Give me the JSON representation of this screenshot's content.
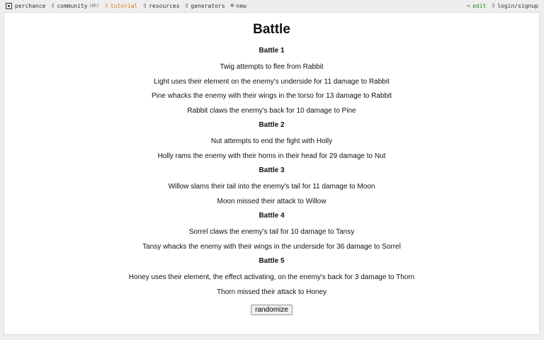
{
  "nav": {
    "left": [
      {
        "icon": "dice-icon",
        "label": "perchance"
      },
      {
        "icon": "chat-icon",
        "label": "community",
        "count": "(8h)"
      },
      {
        "icon": "book-icon",
        "label": "tutorial"
      },
      {
        "icon": "folder-icon",
        "label": "resources"
      },
      {
        "icon": "list-icon",
        "label": "generators"
      },
      {
        "icon": "plus-icon",
        "label": "new"
      }
    ],
    "right": [
      {
        "icon": "pencil-icon",
        "label": "edit"
      },
      {
        "icon": "user-icon",
        "label": "login/signup"
      }
    ]
  },
  "colors": {
    "tutorial": "#e07b18",
    "edit": "#2a8a2a"
  },
  "page": {
    "title": "Battle",
    "battles": [
      {
        "heading": "Battle 1",
        "lines": [
          "Twig attempts to flee from Rabbit",
          "Light uses their element on the enemy's underside for 11 damage to Rabbit",
          "Pine whacks the enemy with their wings in the torso for 13 damage to Rabbit",
          "Rabbit claws the enemy's back for 10 damage to Pine"
        ]
      },
      {
        "heading": "Battle 2",
        "lines": [
          "Nut attempts to end the fight with Holly",
          "Holly rams the enemy with their horns in their head for 29 damage to Nut"
        ]
      },
      {
        "heading": "Battle 3",
        "lines": [
          "Willow slams their tail into the enemy's tail for 11 damage to Moon",
          "Moon missed their attack to Willow"
        ]
      },
      {
        "heading": "Battle 4",
        "lines": [
          "Sorrel claws the enemy's tail for 10 damage to Tansy",
          "Tansy whacks the enemy with their wings in the underside for 36 damage to Sorrel"
        ]
      },
      {
        "heading": "Battle 5",
        "lines": [
          "Honey uses their element, the effect activating, on the enemy's back for 3 damage to Thorn",
          "Thorn missed their attack to Honey"
        ]
      }
    ],
    "button_label": "randomize"
  }
}
